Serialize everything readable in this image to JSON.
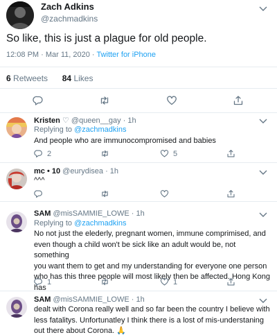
{
  "main_tweet": {
    "author_name": "Zach Adkins",
    "author_handle": "@zachmadkins",
    "text": "So like, this is just a plague for old people.",
    "time": "12:08 PM · Mar 11, 2020 · ",
    "source": "Twitter for iPhone",
    "retweets": "6",
    "retweets_label": "Retweets",
    "likes": "84",
    "likes_label": "Likes"
  },
  "replies": [
    {
      "name": "Kristen",
      "badge": "♡",
      "handle_time": "@queen__gay · 1h",
      "replying_prefix": "Replying to ",
      "replying_to": "@zachmadkins",
      "text": "And people who are immunocompromised and babies",
      "reply_count": "2",
      "retweet_count": "",
      "like_count": "5"
    },
    {
      "name": "mc • 10",
      "handle_time": "@eurydisea · 1h",
      "text": "^^^",
      "reply_count": "",
      "retweet_count": "",
      "like_count": ""
    },
    {
      "name": "SAM",
      "handle_time": "@misSAMMIE_LOWE · 1h",
      "replying_prefix": "Replying to ",
      "replying_to": "@zachmadkins",
      "text_lines": [
        "No not just the elederly, pregnant women, immune comprimised, and",
        "even though a child won't be sick like an adult would be, not something",
        "you want them to get and my understanding for everyone one person",
        "who has this three people will most likely then be affected.  Hong Kong",
        "has"
      ],
      "reply_count": "1",
      "retweet_count": "",
      "like_count": "1"
    },
    {
      "name": "SAM",
      "handle_time": "@misSAMMIE_LOWE · 1h",
      "text_lines": [
        "dealt with Corona really well and so far been the country I believe with",
        "less fatalitys.  Unfortunatley I think there is a lost of mis-understaning",
        "out there about Corona."
      ],
      "emoji": "🙏"
    }
  ],
  "colors": {
    "link": "#1da1f2",
    "muted": "#657786",
    "divider": "#e6ecf0"
  }
}
